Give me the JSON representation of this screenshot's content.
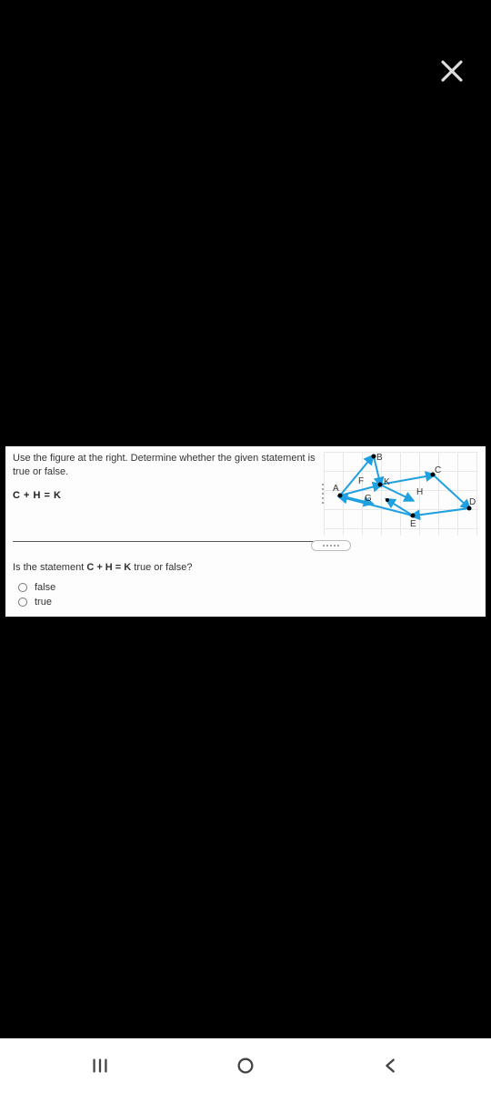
{
  "close": {
    "aria": "Close"
  },
  "card": {
    "instruction": "Use the figure at the right. Determine whether the given statement is true or false.",
    "equation": "C + H = K",
    "figure": {
      "labels": {
        "A": "A",
        "B": "B",
        "C": "C",
        "D": "D",
        "E": "E",
        "F": "F",
        "G": "G",
        "H": "H",
        "K": "K"
      }
    },
    "question": {
      "prefix": "Is the statement ",
      "expr": "C + H = K",
      "suffix": " true or false?"
    },
    "options": [
      {
        "label": "false"
      },
      {
        "label": "true"
      }
    ]
  },
  "nav": {
    "recents": "Recents",
    "home": "Home",
    "back": "Back"
  }
}
